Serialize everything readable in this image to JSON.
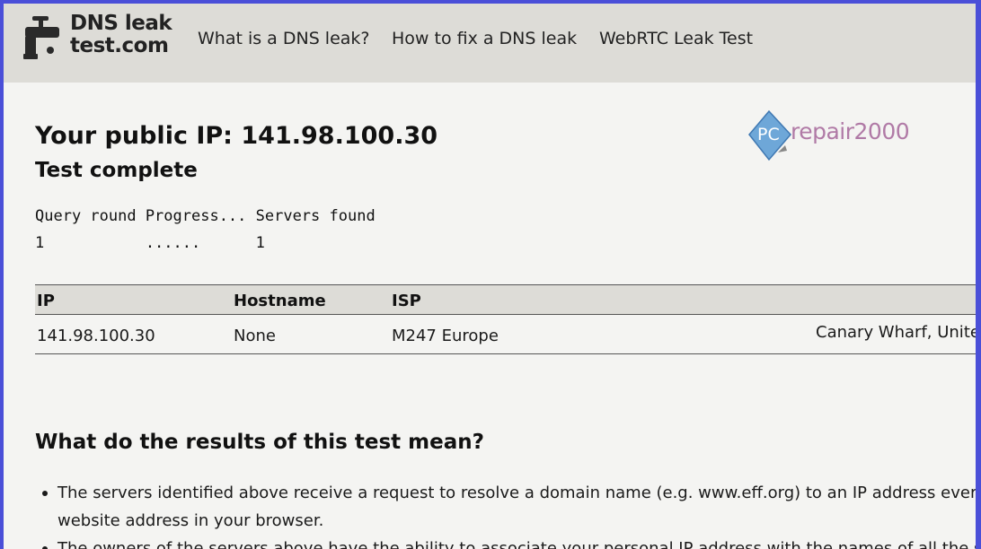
{
  "header": {
    "logo_line1": "DNS leak",
    "logo_line2": "test.com",
    "nav": [
      {
        "label": "What is a DNS leak?"
      },
      {
        "label": "How to fix a DNS leak"
      },
      {
        "label": "WebRTC Leak Test"
      }
    ]
  },
  "main": {
    "title": "Your public IP: 141.98.100.30",
    "status": "Test complete",
    "query_header": "Query round Progress... Servers found",
    "query_row": "1           ......      1",
    "table": {
      "headers": [
        "IP",
        "Hostname",
        "ISP"
      ],
      "rows": [
        {
          "ip": "141.98.100.30",
          "hostname": "None",
          "isp": "M247 Europe",
          "location": "Canary Wharf, United"
        }
      ]
    },
    "results_heading": "What do the results of this test mean?",
    "results_items": [
      "The servers identified above receive a request to resolve a domain name (e.g. www.eff.org) to an IP address every time",
      "website address in your browser.",
      "The owners of the servers above have the ability to associate your personal IP address with the names of all the sites"
    ]
  },
  "watermark": {
    "pc": "PC",
    "text": "repair2000"
  },
  "colors": {
    "header_bg": "#dddcd7",
    "page_bg": "#f4f4f2",
    "frame": "#4a4fd8",
    "watermark": "#b07aa6",
    "watermark_diamond": "#6ea7d8"
  }
}
